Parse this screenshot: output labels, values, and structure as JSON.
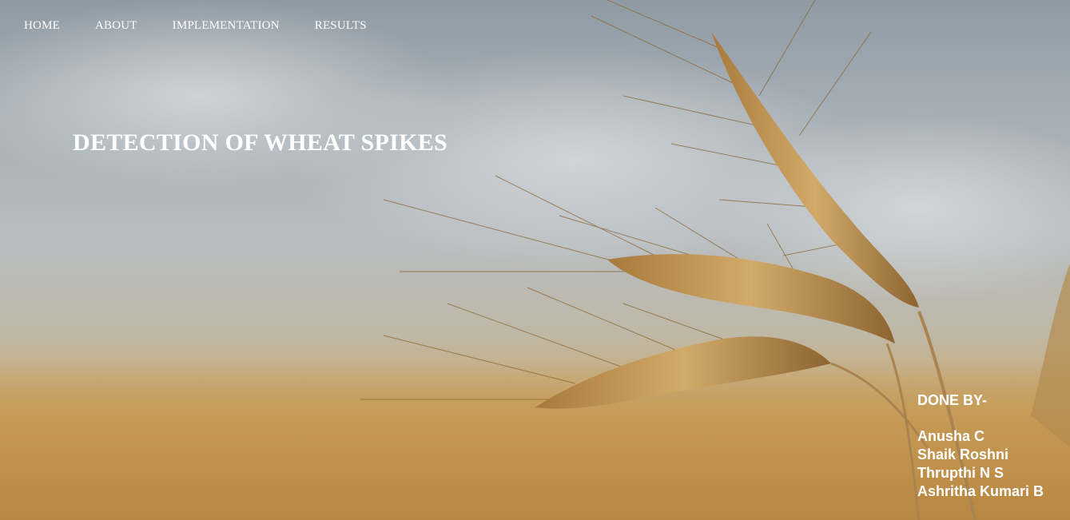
{
  "nav": {
    "items": [
      {
        "label": "HOME"
      },
      {
        "label": "ABOUT"
      },
      {
        "label": "IMPLEMENTATION"
      },
      {
        "label": "RESULTS"
      }
    ]
  },
  "hero": {
    "title": "DETECTION OF WHEAT SPIKES",
    "background_image": "wheat-spikes-field-photo"
  },
  "credits": {
    "heading": "DONE BY-",
    "members": [
      "Anusha C",
      "Shaik Roshni",
      "Thrupthi N S",
      "Ashritha Kumari B"
    ]
  },
  "colors": {
    "text": "#ffffff",
    "sky": "#a4adb4",
    "wheat": "#c69b56"
  }
}
